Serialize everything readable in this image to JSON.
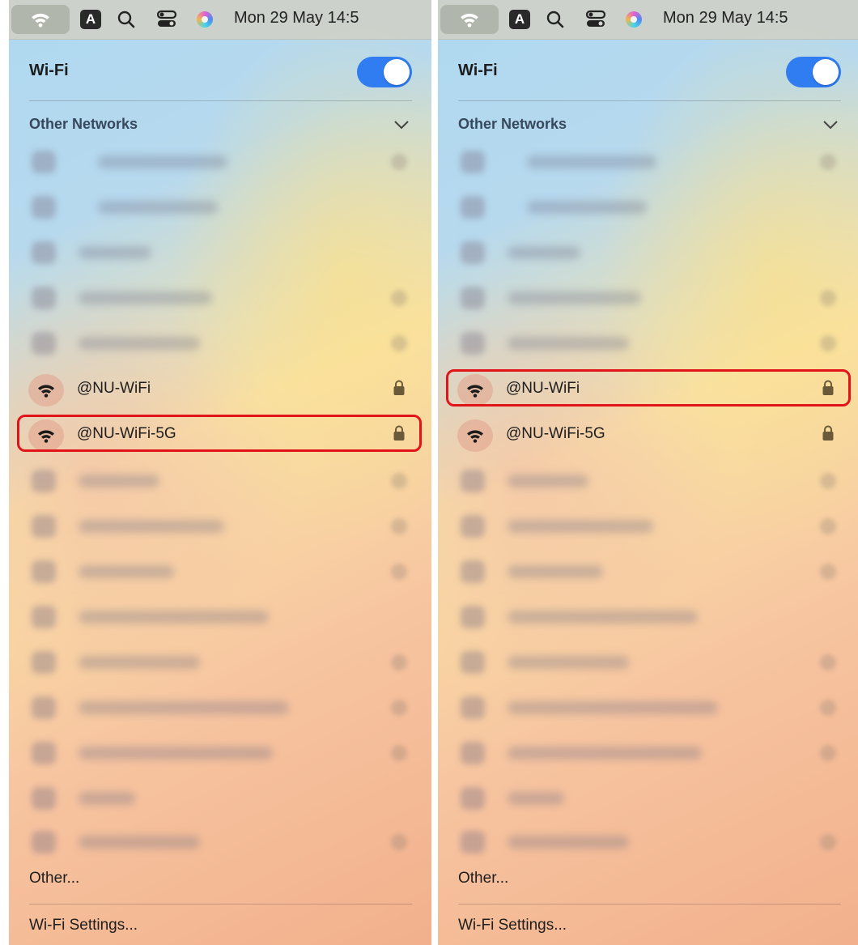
{
  "menubar": {
    "input_source": "A",
    "clock": "Mon 29 May 14:5"
  },
  "wifi_header": {
    "title": "Wi-Fi",
    "toggle_on": true
  },
  "other_networks": {
    "title": "Other Networks"
  },
  "networks": {
    "nu_wifi": {
      "name": "@NU-WiFi",
      "secured": true
    },
    "nu_wifi_5g": {
      "name": "@NU-WiFi-5G",
      "secured": true
    }
  },
  "footer": {
    "other": "Other...",
    "settings": "Wi-Fi Settings..."
  },
  "panels": {
    "left": {
      "highlighted": "@NU-WiFi-5G"
    },
    "right": {
      "highlighted": "@NU-WiFi"
    }
  },
  "colors": {
    "accent": "#2f7df0",
    "highlight": "#e1141a"
  },
  "icons": [
    "wifi-icon",
    "search-icon",
    "control-center-icon",
    "siri-icon",
    "chevron-down-icon",
    "lock-icon"
  ]
}
